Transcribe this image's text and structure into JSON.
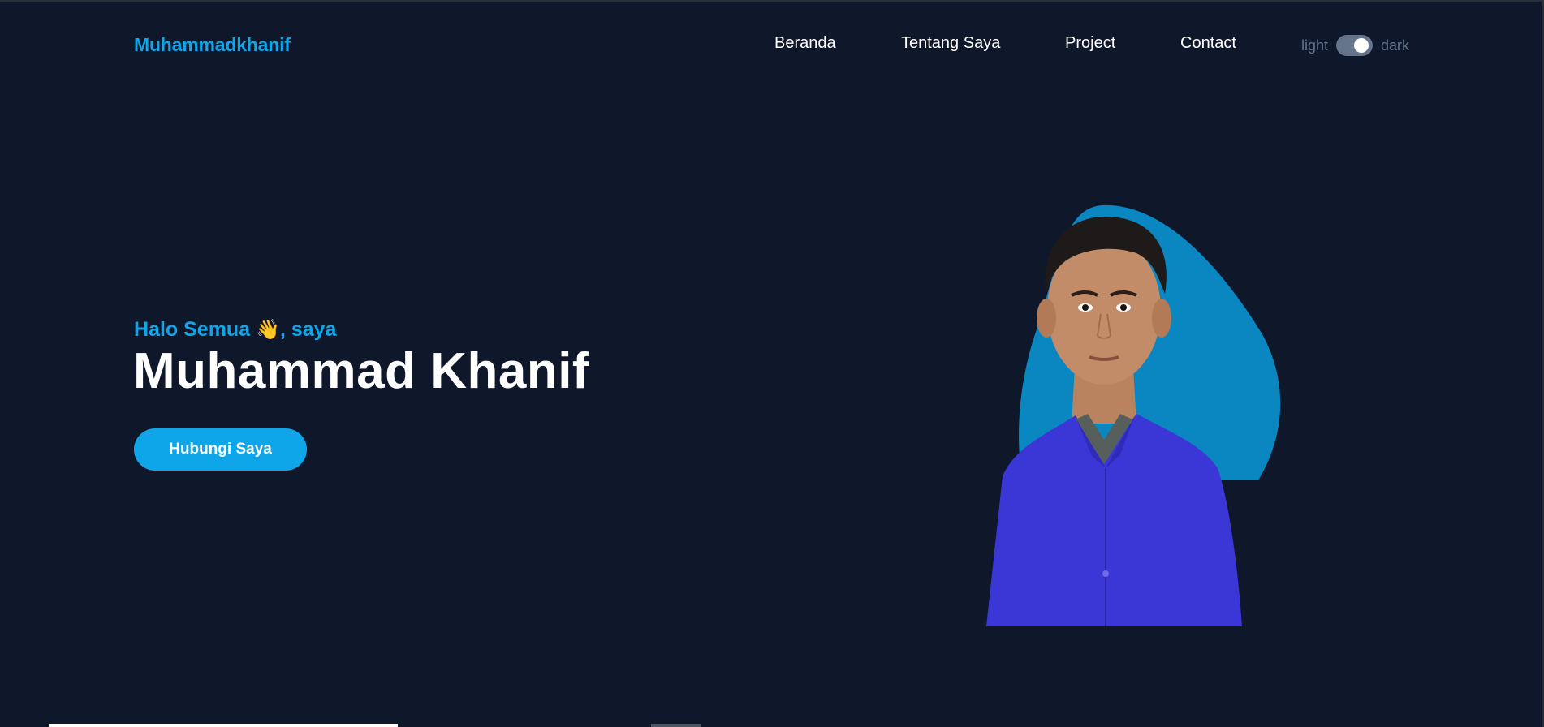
{
  "header": {
    "brand": "Muhammadkhanif",
    "nav": [
      {
        "label": "Beranda"
      },
      {
        "label": "Tentang Saya"
      },
      {
        "label": "Project"
      },
      {
        "label": "Contact"
      }
    ],
    "theme_switch": {
      "light_label": "light",
      "dark_label": "dark",
      "state": "dark"
    }
  },
  "hero": {
    "greeting_prefix": "Halo Semua ",
    "greeting_emoji": "👋",
    "greeting_suffix": ", saya",
    "name": "Muhammad Khanif",
    "cta_label": "Hubungi Saya"
  },
  "colors": {
    "background": "#0f172a",
    "accent": "#0ea5e9",
    "blob": "#0a86c0",
    "shirt": "#3b36d6"
  }
}
